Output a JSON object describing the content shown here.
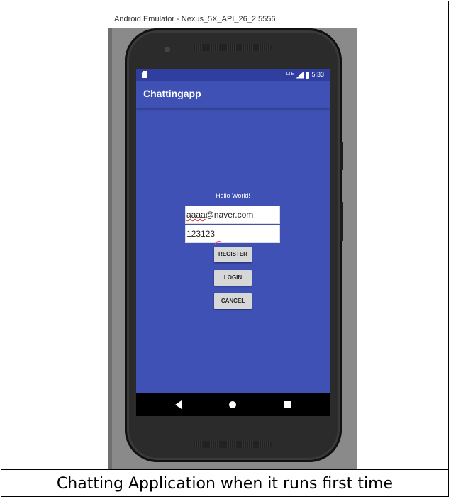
{
  "emulator": {
    "window_title": "Android Emulator - Nexus_5X_API_26_2:5556"
  },
  "status_bar": {
    "time": "5:33",
    "network_label": "LTE"
  },
  "app": {
    "title": "Chattingapp",
    "theme_color": "#3f51b5"
  },
  "main": {
    "greeting": "Hello World!",
    "email_value": "aaaa@naver.com",
    "email_underlined_part": "aaaa",
    "email_rest": "@naver.com",
    "password_value": "123123",
    "register_label": "REGISTER",
    "login_label": "LOGIN",
    "cancel_label": "CANCEL"
  },
  "nav_bar": {
    "icons": [
      "back-icon",
      "home-icon",
      "recents-icon"
    ]
  },
  "caption": "Chatting Application when it runs first time"
}
